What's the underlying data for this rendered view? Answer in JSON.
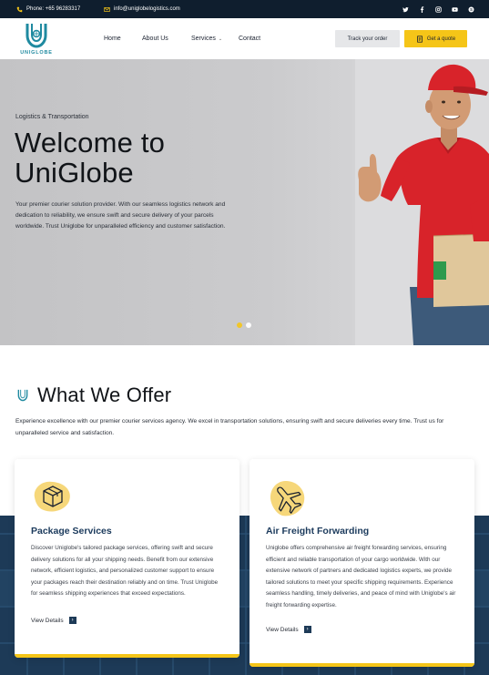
{
  "topbar": {
    "phone": "Phone: +65 96283317",
    "email": "info@uniglobelogistics.com",
    "socials": [
      "twitter-icon",
      "facebook-icon",
      "instagram-icon",
      "youtube-icon",
      "skype-icon"
    ]
  },
  "header": {
    "logo_text": "UNIGLOBE",
    "nav": {
      "home": "Home",
      "about": "About Us",
      "services": "Services",
      "contact": "Contact"
    },
    "track_button": "Track your order",
    "quote_button": "Get a quote"
  },
  "hero": {
    "eyebrow": "Logistics & Transportation",
    "title": "Welcome to UniGlobe",
    "description": "Your premier courier solution provider. With our seamless logistics network and dedication to reliability, we ensure swift and secure delivery of your parcels worldwide. Trust Uniglobe for unparalleled efficiency and customer satisfaction.",
    "slides": 2,
    "active_slide": 1
  },
  "offer": {
    "title": "What We Offer",
    "description": "Experience excellence with our premier courier services agency. We excel in transportation solutions, ensuring swift and secure deliveries every time. Trust us for unparalleled service and satisfaction.",
    "cards": [
      {
        "icon": "package-icon",
        "title": "Package Services",
        "text": "Discover Uniglobe's tailored package services, offering swift and secure delivery solutions for all your shipping needs. Benefit from our extensive network, efficient logistics, and personalized customer support to ensure your packages reach their destination reliably and on time. Trust Uniglobe for seamless shipping experiences that exceed expectations.",
        "link": "View Details"
      },
      {
        "icon": "airplane-icon",
        "title": "Air Freight Forwarding",
        "text": "Uniglobe offers comprehensive air freight forwarding services, ensuring efficient and reliable transportation of your cargo worldwide. With our extensive network of partners and dedicated logistics experts, we provide tailored solutions to meet your specific shipping requirements. Experience seamless handling, timely deliveries, and peace of mind with Uniglobe's air freight forwarding expertise.",
        "link": "View Details"
      }
    ]
  },
  "colors": {
    "topbar": "#0f1e2e",
    "accent": "#f5c518",
    "navy": "#1d3a57",
    "teal": "#1f8aa0"
  }
}
